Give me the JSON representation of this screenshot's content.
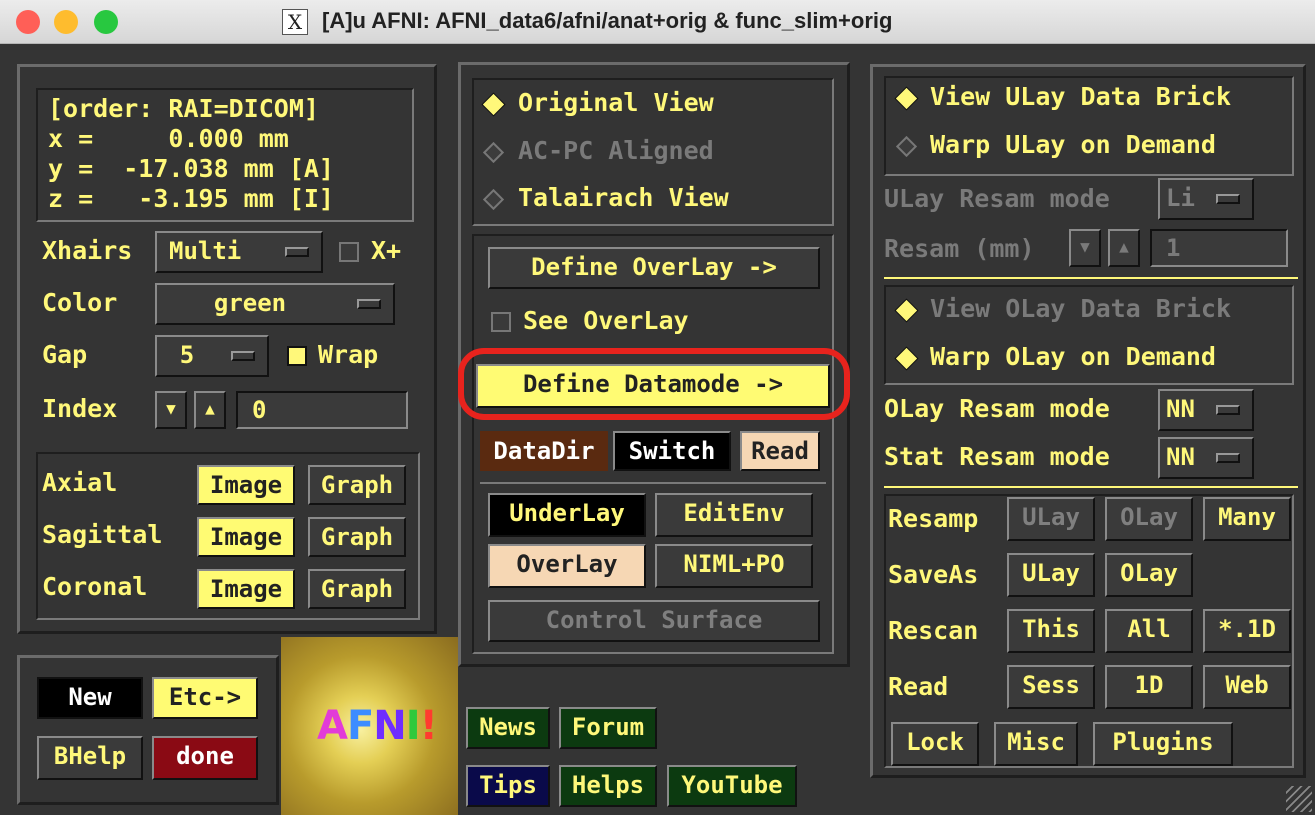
{
  "window": {
    "title": "[A]u AFNI: AFNI_data6/afni/anat+orig & func_slim+orig",
    "x_icon": "X"
  },
  "coords": {
    "order": "[order: RAI=DICOM]",
    "x": "x =     0.000 mm",
    "y": "y =  -17.038 mm [A]",
    "z": "z =   -3.195 mm [I]"
  },
  "xhairs": {
    "label": "Xhairs",
    "value": "Multi",
    "xplus": "X+"
  },
  "color": {
    "label": "Color",
    "value": "green"
  },
  "gap": {
    "label": "Gap",
    "value": "5",
    "wrap": "Wrap"
  },
  "index": {
    "label": "Index",
    "value": "0"
  },
  "views": [
    {
      "name": "Axial",
      "image": "Image",
      "graph": "Graph"
    },
    {
      "name": "Sagittal",
      "image": "Image",
      "graph": "Graph"
    },
    {
      "name": "Coronal",
      "image": "Image",
      "graph": "Graph"
    }
  ],
  "bottom_left": {
    "new": "New",
    "etc": "Etc->",
    "bhelp": "BHelp",
    "done": "done"
  },
  "logo": {
    "letters": [
      "A",
      "F",
      "N",
      "I",
      "!"
    ],
    "colors": [
      "#e23bd8",
      "#3c8cff",
      "#6f2dff",
      "#2fc93c",
      "#ff3b2f"
    ]
  },
  "view_modes": {
    "original": "Original View",
    "acpc": "AC-PC Aligned",
    "talairach": "Talairach View"
  },
  "middle": {
    "define_overlay": "Define OverLay ->",
    "see_overlay": "See OverLay",
    "define_datamode": "Define Datamode ->",
    "datadir": "DataDir",
    "switch": "Switch",
    "read": "Read",
    "underlay": "UnderLay",
    "editenv": "EditEnv",
    "overlay": "OverLay",
    "niml": "NIML+PO",
    "control_surface": "Control Surface"
  },
  "help_buttons": {
    "news": "News",
    "forum": "Forum",
    "tips": "Tips",
    "helps": "Helps",
    "youtube": "YouTube"
  },
  "right": {
    "view_ulay": "View ULay Data Brick",
    "warp_ulay": "Warp ULay on Demand",
    "ulay_resam_label": "ULay Resam mode",
    "ulay_resam_value": "Li",
    "resam_mm_label": "Resam (mm)",
    "resam_mm_value": "1",
    "view_olay": "View OLay Data Brick",
    "warp_olay": "Warp OLay on Demand",
    "olay_resam_label": "OLay Resam mode",
    "olay_resam_value": "NN",
    "stat_resam_label": "Stat Resam mode",
    "stat_resam_value": "NN",
    "resamp": "Resamp",
    "resamp_ulay": "ULay",
    "resamp_olay": "OLay",
    "many": "Many",
    "saveas": "SaveAs",
    "save_ulay": "ULay",
    "save_olay": "OLay",
    "rescan": "Rescan",
    "this": "This",
    "all": "All",
    "star1d": "*.1D",
    "read": "Read",
    "sess": "Sess",
    "oned": "1D",
    "web": "Web",
    "lock": "Lock",
    "misc": "Misc",
    "plugins": "Plugins"
  },
  "colors": {
    "accent": "#fff87a",
    "highlight_ring": "#e8231d",
    "panel_bg": "#343434"
  }
}
